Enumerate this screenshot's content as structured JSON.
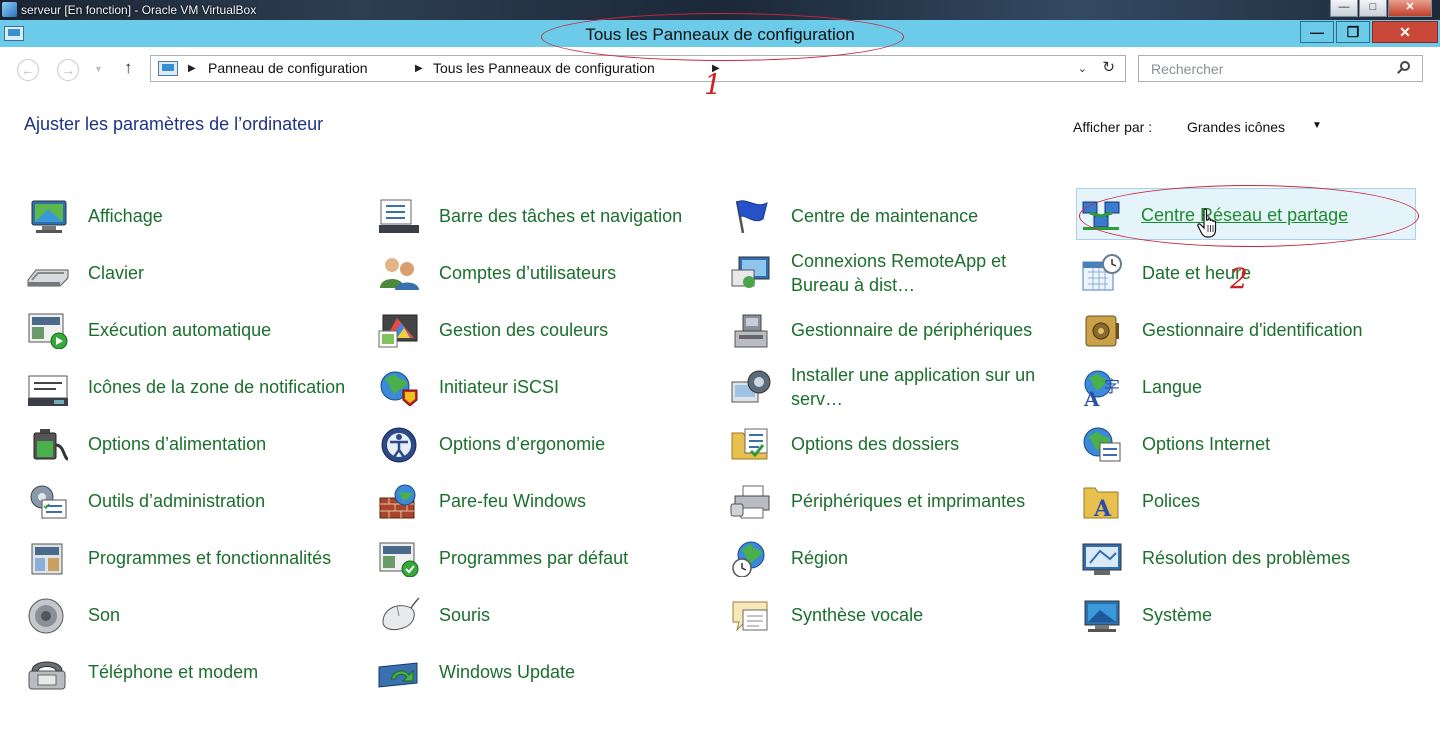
{
  "host": {
    "title": "serveur [En fonction] - Oracle VM VirtualBox"
  },
  "window": {
    "title": "Tous les Panneaux de configuration"
  },
  "address": {
    "crumbs": [
      "Panneau de configuration",
      "Tous les Panneaux de configuration"
    ]
  },
  "search": {
    "placeholder": "Rechercher"
  },
  "header": {
    "title": "Ajuster les paramètres de l’ordinateur",
    "view_label": "Afficher par :",
    "view_value": "Grandes icônes"
  },
  "annotations": [
    "1",
    "2"
  ],
  "items": [
    {
      "label": "Affichage",
      "icon": "display-icon"
    },
    {
      "label": "Barre des tâches et navigation",
      "icon": "taskbar-icon"
    },
    {
      "label": "Centre de maintenance",
      "icon": "flag-icon"
    },
    {
      "label": "Centre Réseau et partage",
      "icon": "network-icon"
    },
    {
      "label": "Clavier",
      "icon": "keyboard-icon"
    },
    {
      "label": "Comptes d’utilisateurs",
      "icon": "users-icon"
    },
    {
      "label": "Connexions RemoteApp et Bureau à dist…",
      "icon": "remoteapp-icon"
    },
    {
      "label": "Date et heure",
      "icon": "calendar-clock-icon"
    },
    {
      "label": "Exécution automatique",
      "icon": "autoplay-icon"
    },
    {
      "label": "Gestion des couleurs",
      "icon": "color-management-icon"
    },
    {
      "label": "Gestionnaire de périphériques",
      "icon": "device-manager-icon"
    },
    {
      "label": "Gestionnaire d'identification",
      "icon": "credential-vault-icon"
    },
    {
      "label": "Icônes de la zone de notification",
      "icon": "notification-area-icon"
    },
    {
      "label": "Initiateur iSCSI",
      "icon": "iscsi-globe-icon"
    },
    {
      "label": "Installer une application sur un serv…",
      "icon": "install-app-icon"
    },
    {
      "label": "Langue",
      "icon": "language-icon"
    },
    {
      "label": "Options d’alimentation",
      "icon": "battery-icon"
    },
    {
      "label": "Options d’ergonomie",
      "icon": "ease-of-access-icon"
    },
    {
      "label": "Options des dossiers",
      "icon": "folder-options-icon"
    },
    {
      "label": "Options Internet",
      "icon": "internet-options-icon"
    },
    {
      "label": "Outils d’administration",
      "icon": "admin-tools-icon"
    },
    {
      "label": "Pare-feu Windows",
      "icon": "firewall-icon"
    },
    {
      "label": "Périphériques et imprimantes",
      "icon": "printer-icon"
    },
    {
      "label": "Polices",
      "icon": "fonts-folder-icon"
    },
    {
      "label": "Programmes et fonctionnalités",
      "icon": "programs-icon"
    },
    {
      "label": "Programmes par défaut",
      "icon": "default-programs-icon"
    },
    {
      "label": "Région",
      "icon": "region-globe-icon"
    },
    {
      "label": "Résolution des problèmes",
      "icon": "troubleshooting-icon"
    },
    {
      "label": "Son",
      "icon": "speaker-icon"
    },
    {
      "label": "Souris",
      "icon": "mouse-icon"
    },
    {
      "label": "Synthèse vocale",
      "icon": "speech-bubble-icon"
    },
    {
      "label": "Système",
      "icon": "system-icon"
    },
    {
      "label": "Téléphone et modem",
      "icon": "phone-modem-icon"
    },
    {
      "label": "Windows Update",
      "icon": "windows-update-icon"
    }
  ]
}
